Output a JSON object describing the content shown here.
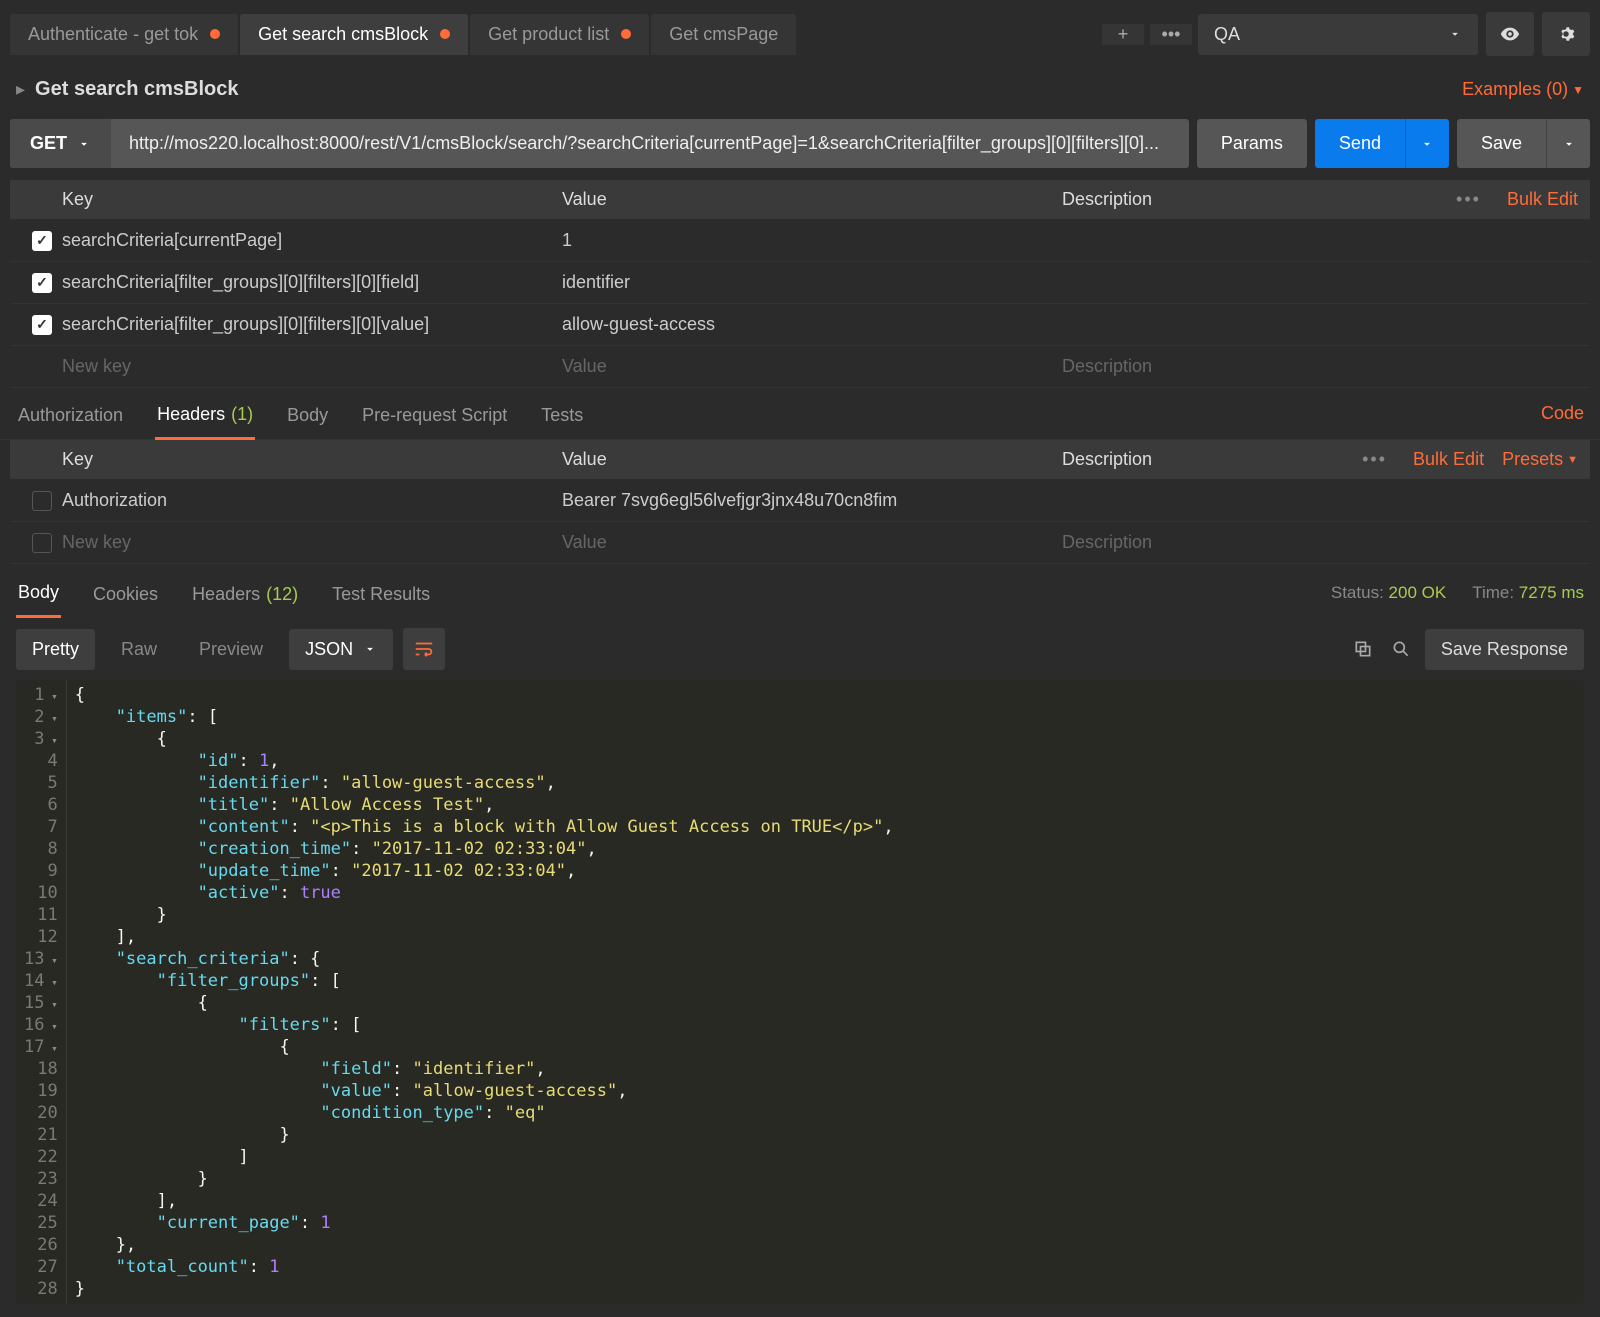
{
  "tabs": [
    {
      "label": "Authenticate - get tok",
      "dirty": true,
      "active": false
    },
    {
      "label": "Get search cmsBlock",
      "dirty": true,
      "active": true
    },
    {
      "label": "Get product list",
      "dirty": true,
      "active": false
    },
    {
      "label": "Get cmsPage",
      "dirty": false,
      "active": false
    }
  ],
  "environment": "QA",
  "breadcrumb": "Get search cmsBlock",
  "examples_label": "Examples (0)",
  "method": "GET",
  "url": "http://mos220.localhost:8000/rest/V1/cmsBlock/search/?searchCriteria[currentPage]=1&searchCriteria[filter_groups][0][filters][0]...",
  "btn_params": "Params",
  "btn_send": "Send",
  "btn_save": "Save",
  "params_head": {
    "key": "Key",
    "value": "Value",
    "desc": "Description"
  },
  "bulk_edit": "Bulk Edit",
  "presets": "Presets",
  "params_rows": [
    {
      "checked": true,
      "key": "searchCriteria[currentPage]",
      "value": "1"
    },
    {
      "checked": true,
      "key": "searchCriteria[filter_groups][0][filters][0][field]",
      "value": "identifier"
    },
    {
      "checked": true,
      "key": "searchCriteria[filter_groups][0][filters][0][value]",
      "value": "allow-guest-access"
    }
  ],
  "params_new": {
    "key": "New key",
    "value": "Value",
    "desc": "Description"
  },
  "sub_tabs": {
    "authorization": "Authorization",
    "headers": "Headers",
    "headers_count": "(1)",
    "body": "Body",
    "prerequest": "Pre-request Script",
    "tests": "Tests",
    "code": "Code"
  },
  "headers_rows": [
    {
      "key": "Authorization",
      "value": "Bearer 7svg6egl56lvefjgr3jnx48u70cn8fim"
    }
  ],
  "headers_head": {
    "key": "Key",
    "value": "Value",
    "desc": "Description"
  },
  "resp_tabs": {
    "body": "Body",
    "cookies": "Cookies",
    "headers": "Headers",
    "headers_count": "(12)",
    "test_results": "Test Results"
  },
  "status_label": "Status:",
  "status_value": "200 OK",
  "time_label": "Time:",
  "time_value": "7275 ms",
  "view_modes": {
    "pretty": "Pretty",
    "raw": "Raw",
    "preview": "Preview"
  },
  "format": "JSON",
  "save_response": "Save Response",
  "code_lines": [
    "<span class='punc'>{</span>",
    "    <span class='key'>\"items\"</span><span class='punc'>: [</span>",
    "        <span class='punc'>{</span>",
    "            <span class='key'>\"id\"</span><span class='punc'>: </span><span class='num'>1</span><span class='punc'>,</span>",
    "            <span class='key'>\"identifier\"</span><span class='punc'>: </span><span class='str'>\"allow-guest-access\"</span><span class='punc'>,</span>",
    "            <span class='key'>\"title\"</span><span class='punc'>: </span><span class='str'>\"Allow Access Test\"</span><span class='punc'>,</span>",
    "            <span class='key'>\"content\"</span><span class='punc'>: </span><span class='str'>\"&lt;p&gt;This is a block with Allow Guest Access on TRUE&lt;/p&gt;\"</span><span class='punc'>,</span>",
    "            <span class='key'>\"creation_time\"</span><span class='punc'>: </span><span class='str'>\"2017-11-02 02:33:04\"</span><span class='punc'>,</span>",
    "            <span class='key'>\"update_time\"</span><span class='punc'>: </span><span class='str'>\"2017-11-02 02:33:04\"</span><span class='punc'>,</span>",
    "            <span class='key'>\"active\"</span><span class='punc'>: </span><span class='bool'>true</span>",
    "        <span class='punc'>}</span>",
    "    <span class='punc'>],</span>",
    "    <span class='key'>\"search_criteria\"</span><span class='punc'>: {</span>",
    "        <span class='key'>\"filter_groups\"</span><span class='punc'>: [</span>",
    "            <span class='punc'>{</span>",
    "                <span class='key'>\"filters\"</span><span class='punc'>: [</span>",
    "                    <span class='punc'>{</span>",
    "                        <span class='key'>\"field\"</span><span class='punc'>: </span><span class='str'>\"identifier\"</span><span class='punc'>,</span>",
    "                        <span class='key'>\"value\"</span><span class='punc'>: </span><span class='str'>\"allow-guest-access\"</span><span class='punc'>,</span>",
    "                        <span class='key'>\"condition_type\"</span><span class='punc'>: </span><span class='str'>\"eq\"</span>",
    "                    <span class='punc'>}</span>",
    "                <span class='punc'>]</span>",
    "            <span class='punc'>}</span>",
    "        <span class='punc'>],</span>",
    "        <span class='key'>\"current_page\"</span><span class='punc'>: </span><span class='num'>1</span>",
    "    <span class='punc'>},</span>",
    "    <span class='key'>\"total_count\"</span><span class='punc'>: </span><span class='num'>1</span>",
    "<span class='punc'>}</span>"
  ],
  "fold_lines": [
    1,
    2,
    3,
    13,
    14,
    15,
    16,
    17
  ]
}
